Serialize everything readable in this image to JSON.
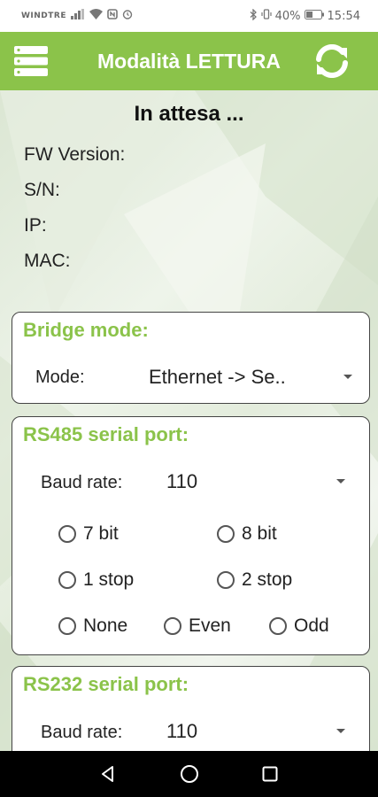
{
  "status_bar": {
    "carrier": "WINDTRE",
    "battery": "40%",
    "time": "15:54"
  },
  "app_bar": {
    "title": "Modalità LETTURA",
    "menu_icon": "menu-icon",
    "refresh_icon": "refresh-icon",
    "color": "#8bc34a"
  },
  "device_info": {
    "status": "In attesa ...",
    "fw_version_label": "FW Version:",
    "sn_label": "S/N:",
    "ip_label": "IP:",
    "mac_label": "MAC:"
  },
  "bridge": {
    "title": "Bridge mode:",
    "mode_label": "Mode:",
    "mode_value": "Ethernet -> Se.."
  },
  "rs485": {
    "title": "RS485 serial port:",
    "baud_label": "Baud rate:",
    "baud_value": "110",
    "bits": [
      "7 bit",
      "8 bit"
    ],
    "stop": [
      "1 stop",
      "2 stop"
    ],
    "parity": [
      "None",
      "Even",
      "Odd"
    ]
  },
  "rs232": {
    "title": "RS232 serial port:",
    "baud_label": "Baud rate:",
    "baud_value": "110"
  },
  "nav_bar": {
    "back_icon": "back-icon",
    "home_icon": "home-icon",
    "recents_icon": "recents-icon"
  }
}
